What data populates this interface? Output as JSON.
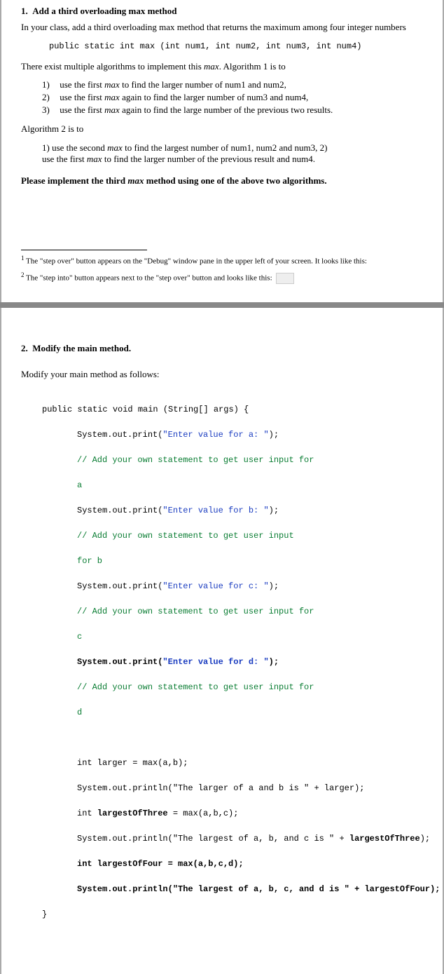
{
  "section1": {
    "number": "1.",
    "title": "Add a third overloading max method",
    "intro": "In your class, add a third overloading max method that returns the maximum among four integer numbers",
    "signature": "public static int max (int num1, int num2, int num3, int num4)",
    "there_exist": "There exist multiple algorithms to implement this ",
    "max_word": "max",
    "there_exist_tail": ". Algorithm 1 is to",
    "alg1": {
      "item1_label": "1)",
      "item1": "use the first ",
      "item1_em": "max",
      "item1_tail": " to find the larger number of num1 and num2,",
      "item2_label": "2)",
      "item2": "use the first ",
      "item2_em": "max",
      "item2_tail": " again to find the larger number of num3 and num4,",
      "item3_label": "3)",
      "item3": "use the first ",
      "item3_em": "max",
      "item3_tail": " again to find the large number of the previous two results."
    },
    "alg2_label": "Algorithm 2 is to",
    "alg2": {
      "item1_label": "1) ",
      "item1": "use the second ",
      "item1_em": "max",
      "item1_tail": " to find the largest number of num1, num2 and num3, 2)",
      "item2": "use the first ",
      "item2_em": "max",
      "item2_tail": " to find the larger number of the previous result and num4."
    },
    "please_pre": "Please implement the third ",
    "please_em": "max",
    "please_post": " method using one of the above two algorithms.",
    "footnote1_sup": "1",
    "footnote1": " The \"step over\" button appears on the \"Debug\" window pane in the upper left of your screen. It looks like this:",
    "footnote2_sup": "2",
    "footnote2": " The \"step into\" button appears next to the \"step over\" button and looks like this:"
  },
  "section2": {
    "number": "2.",
    "title": "Modify the main method.",
    "intro": "Modify your main method as follows:",
    "code": {
      "l1": "public static void main (String[] args) {",
      "l2a": "System.out.print(",
      "l2b": "\"Enter value for a: \"",
      "l2c": ");",
      "l3": "// Add your own statement to get user input for",
      "l3b": "a",
      "l4a": "System.out.print(",
      "l4b": "\"Enter value for b: \"",
      "l4c": ");",
      "l5": "// Add your own statement to get user input",
      "l5b": "for b",
      "l6a": "System.out.print(",
      "l6b": "\"Enter value for c: \"",
      "l6c": ");",
      "l7": "// Add your own statement to get user input for",
      "l7b": "c",
      "l8a": "System.out.print(",
      "l8b": "\"Enter value for d: \"",
      "l8c": ");",
      "l9": "// Add your own statement to get user input for",
      "l9b": "d",
      "l10": "int larger = max(a,b);",
      "l11": "System.out.println(\"The larger of a and b is \" + larger);",
      "l12a": "int ",
      "l12b": "largestOfThree",
      "l12c": " = max(a,b,c);",
      "l13a": "System.out.println(\"The largest of a, b, and c is \" + ",
      "l13b": "largestOfThree",
      "l13c": ");",
      "l14a": "int largestOfFour = max(a,b,c,d);",
      "l15a": "System.out.println(\"The largest of a, b, c, and d is \" + largestOfFour);",
      "l16": "}"
    }
  }
}
